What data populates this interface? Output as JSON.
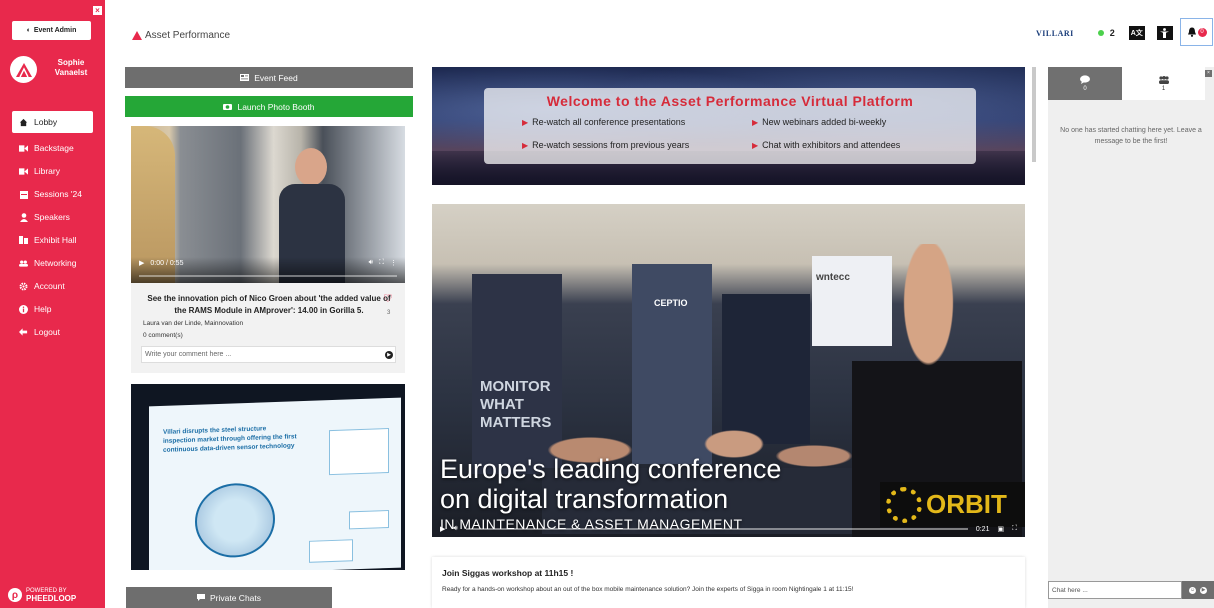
{
  "sidebar": {
    "event_admin_label": "Event Admin",
    "user_name": "Sophie Vanaelst",
    "items": [
      {
        "label": "Lobby",
        "icon": "home-icon"
      },
      {
        "label": "Backstage",
        "icon": "video-camera-icon"
      },
      {
        "label": "Library",
        "icon": "video-camera-icon"
      },
      {
        "label": "Sessions '24",
        "icon": "calendar-icon"
      },
      {
        "label": "Speakers",
        "icon": "person-icon"
      },
      {
        "label": "Exhibit Hall",
        "icon": "exhibit-icon"
      },
      {
        "label": "Networking",
        "icon": "users-icon"
      },
      {
        "label": "Account",
        "icon": "gear-icon"
      },
      {
        "label": "Help",
        "icon": "info-icon"
      },
      {
        "label": "Logout",
        "icon": "logout-icon"
      }
    ],
    "powered_by": "POWERED BY",
    "powered_brand": "PHEEDLOOP"
  },
  "header": {
    "brand": "Asset Performance",
    "sponsor": "VILLARI",
    "online_count": "2",
    "notification_count": "0"
  },
  "feed": {
    "event_feed_label": "Event Feed",
    "photo_booth_label": "Launch Photo Booth",
    "post1": {
      "video_time": "0:00 / 0:55",
      "title": "See the innovation pich of Nico Groen about 'the added value of the RAMS Module in AMprover': 14.00 in Gorilla 5.",
      "likes": "3",
      "author": "Laura van der Linde, Mainnovation",
      "comments": "0 comment(s)",
      "comment_placeholder": "Write your comment here ..."
    },
    "post2": {
      "slide_headline": "Villari disrupts the steel structure inspection market through offering the first continuous data-driven sensor technology"
    },
    "private_chats_label": "Private Chats"
  },
  "banner": {
    "title": "Welcome to the Asset Performance Virtual Platform",
    "points": [
      "Re-watch all conference presentations",
      "New webinars added bi-weekly",
      "Re-watch sessions from previous years",
      "Chat with exhibitors and attendees"
    ]
  },
  "main_video": {
    "headline_1": "Europe's leading conference",
    "headline_2": "on digital transformation",
    "subline": "IN MAINTENANCE & ASSET MANAGEMENT",
    "booth_text": [
      "MONITOR",
      "WHAT",
      "MATTERS"
    ],
    "sign_ceptio": "CEPTIO",
    "sign_wntecc": "wntecc",
    "orbit": "ORBIT",
    "time": "0:21"
  },
  "workshop": {
    "title": "Join Siggas workshop at 11h15 !",
    "body": "Ready for a hands-on workshop about an out of the box mobile maintenance solution? Join the experts of Sigga in room Nightingale 1 at 11:15!"
  },
  "chat": {
    "messages_count": "0",
    "people_count": "1",
    "empty_text": "No one has started chatting here yet. Leave a message to be the first!",
    "input_placeholder": "Chat here ..."
  }
}
